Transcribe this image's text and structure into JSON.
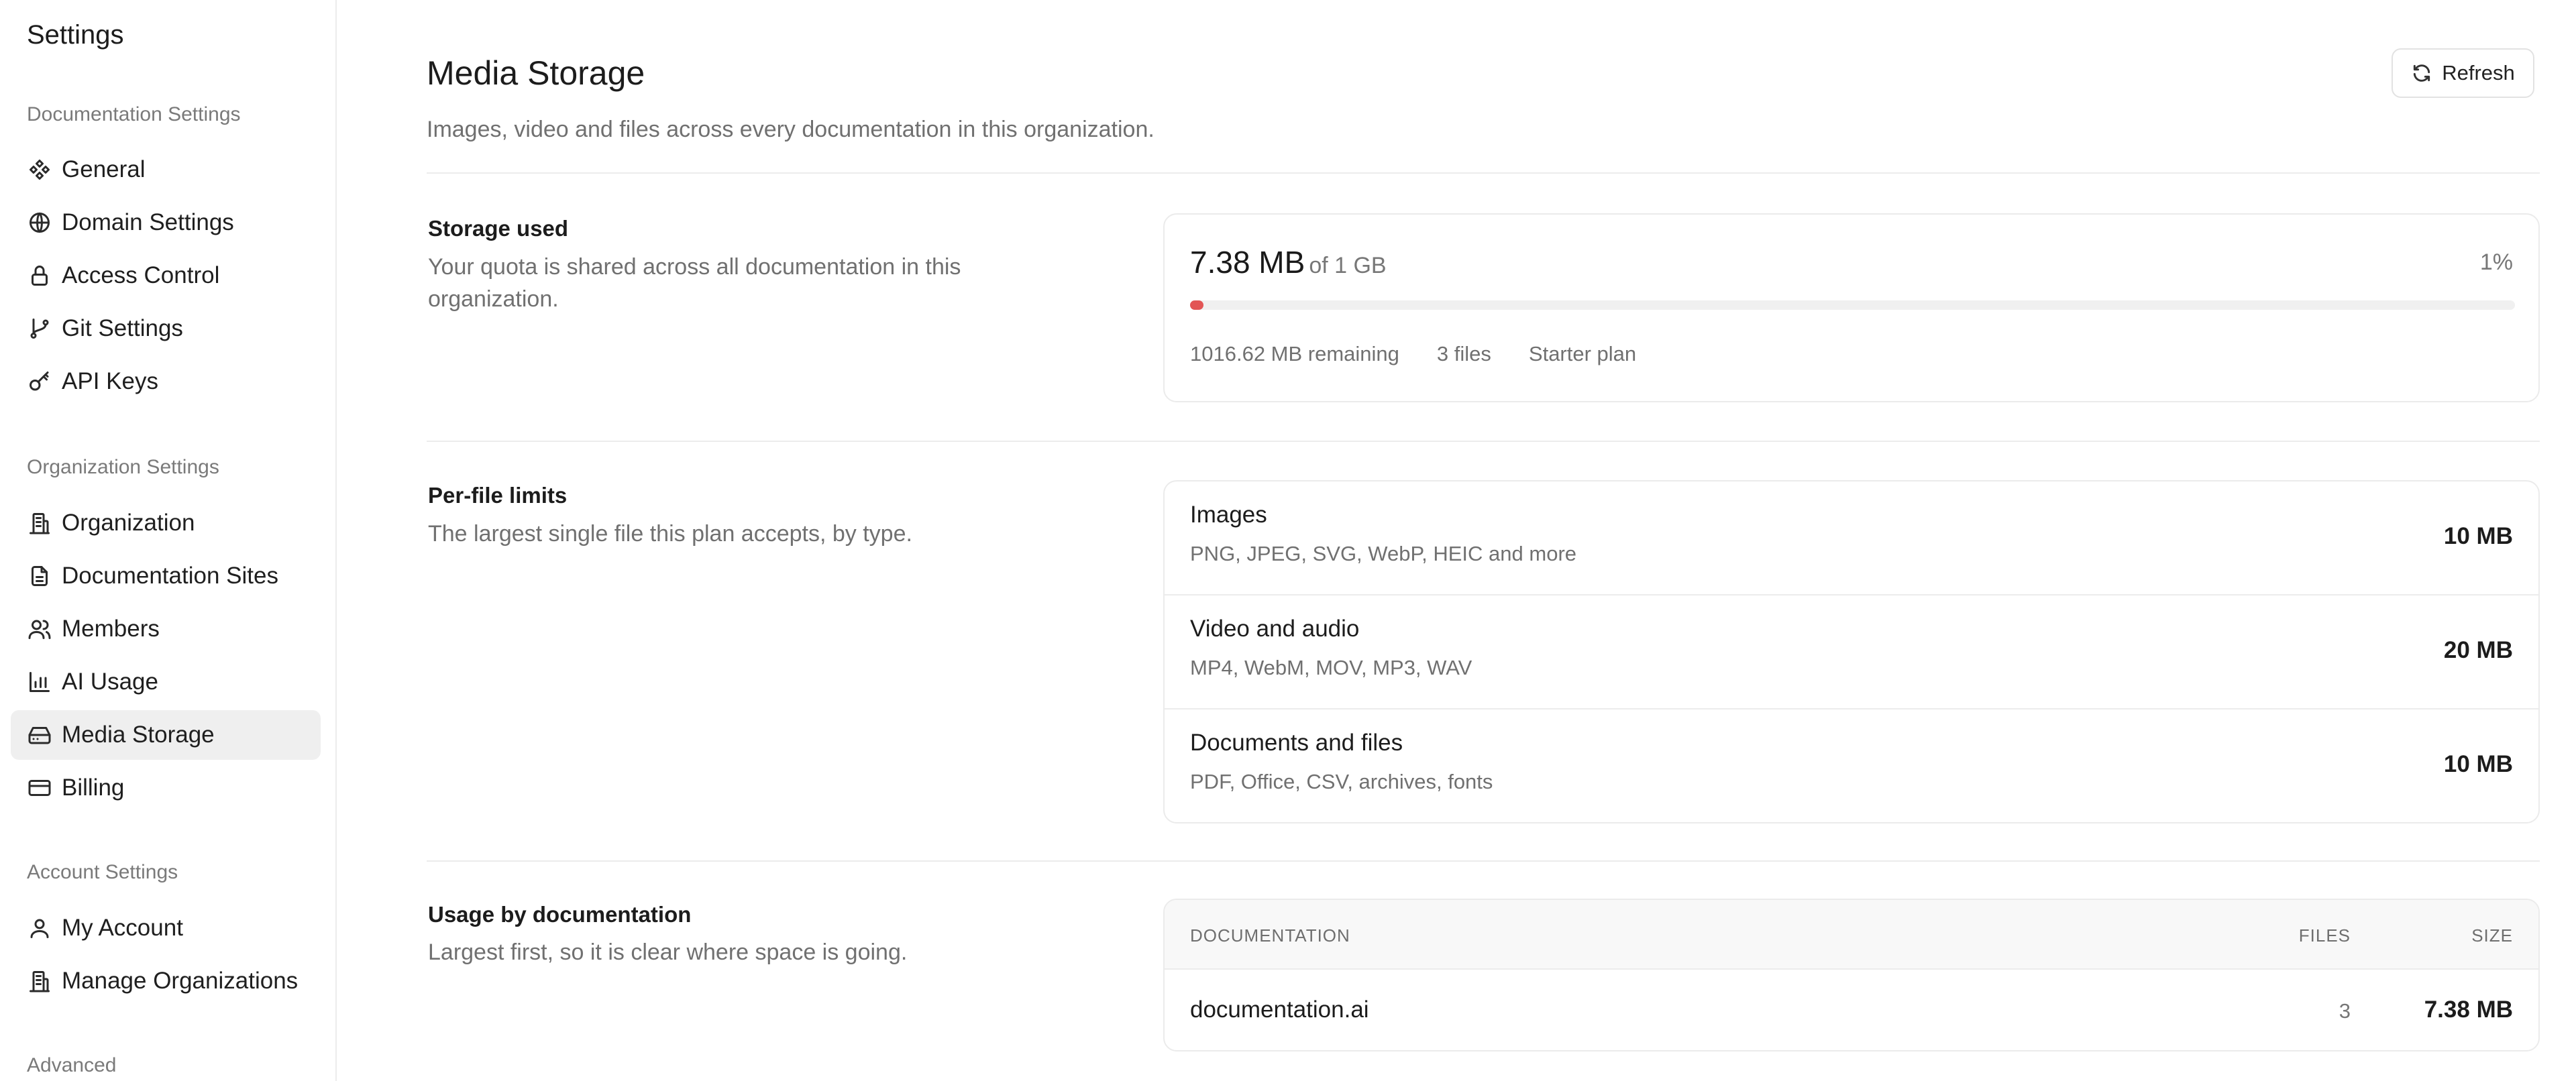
{
  "sidebar": {
    "title": "Settings",
    "sections": {
      "documentation": "Documentation Settings",
      "organization": "Organization Settings",
      "account": "Account Settings",
      "advanced": "Advanced"
    },
    "items": [
      {
        "label": "General",
        "icon": "general-icon"
      },
      {
        "label": "Domain Settings",
        "icon": "globe-icon"
      },
      {
        "label": "Access Control",
        "icon": "lock-icon"
      },
      {
        "label": "Git Settings",
        "icon": "git-branch-icon"
      },
      {
        "label": "API Keys",
        "icon": "key-icon"
      },
      {
        "label": "Organization",
        "icon": "building-icon"
      },
      {
        "label": "Documentation Sites",
        "icon": "document-icon"
      },
      {
        "label": "Members",
        "icon": "users-icon"
      },
      {
        "label": "AI Usage",
        "icon": "bar-chart-icon"
      },
      {
        "label": "Media Storage",
        "icon": "hard-drive-icon",
        "active": true
      },
      {
        "label": "Billing",
        "icon": "credit-card-icon"
      },
      {
        "label": "My Account",
        "icon": "user-icon"
      },
      {
        "label": "Manage Organizations",
        "icon": "building-icon"
      }
    ]
  },
  "header": {
    "title": "Media Storage",
    "subtitle": "Images, video and files across every documentation in this organization.",
    "refresh_label": "Refresh"
  },
  "storage": {
    "title": "Storage used",
    "description": "Your quota is shared across all documentation in this organization.",
    "used": "7.38 MB",
    "quota": "of 1 GB",
    "percent_label": "1%",
    "fill_fraction": 0.0072,
    "remaining": "1016.62 MB remaining",
    "files": "3 files",
    "plan": "Starter plan",
    "bar_color": "#e25555"
  },
  "limits": {
    "title": "Per-file limits",
    "description": "The largest single file this plan accepts, by type.",
    "rows": [
      {
        "name": "Images",
        "types": "PNG, JPEG, SVG, WebP, HEIC and more",
        "size": "10 MB"
      },
      {
        "name": "Video and audio",
        "types": "MP4, WebM, MOV, MP3, WAV",
        "size": "20 MB"
      },
      {
        "name": "Documents and files",
        "types": "PDF, Office, CSV, archives, fonts",
        "size": "10 MB"
      }
    ]
  },
  "usage": {
    "title": "Usage by documentation",
    "description": "Largest first, so it is clear where space is going.",
    "columns": {
      "doc": "DOCUMENTATION",
      "files": "FILES",
      "size": "SIZE"
    },
    "rows": [
      {
        "doc": "documentation.ai",
        "files": "3",
        "size": "7.38 MB"
      }
    ]
  }
}
